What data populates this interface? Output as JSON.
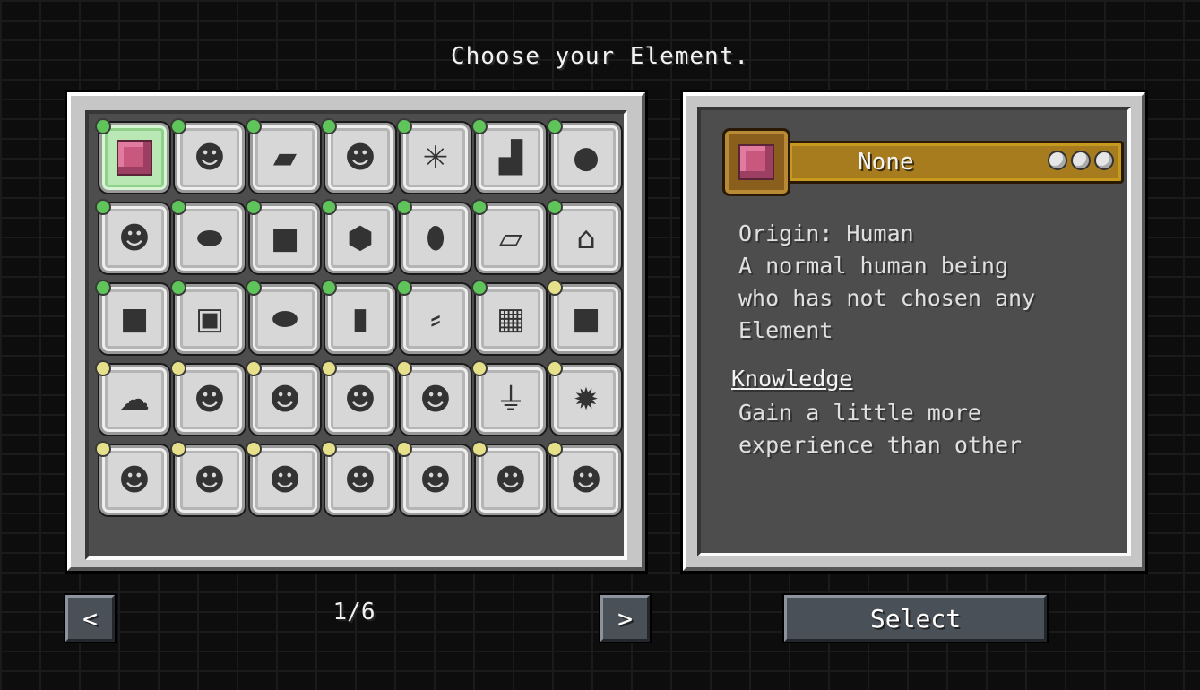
{
  "title": "Choose your Element.",
  "elements": [
    {
      "icon": "pink-cube-icon",
      "glyph": "",
      "dot": "#5fc55a",
      "selected": true
    },
    {
      "icon": "human-portrait-icon",
      "glyph": "☻",
      "dot": "#5fc55a"
    },
    {
      "icon": "purple-book-icon",
      "glyph": "▰",
      "dot": "#5fc55a"
    },
    {
      "icon": "werecat-portrait-icon",
      "glyph": "☻",
      "dot": "#5fc55a"
    },
    {
      "icon": "cobweb-icon",
      "glyph": "✳",
      "dot": "#5fc55a"
    },
    {
      "icon": "dark-altar-icon",
      "glyph": "▟",
      "dot": "#5fc55a"
    },
    {
      "icon": "clay-pot-icon",
      "glyph": "●",
      "dot": "#5fc55a"
    },
    {
      "icon": "goblin-portrait-icon",
      "glyph": "☻",
      "dot": "#5fc55a"
    },
    {
      "icon": "green-slime-icon",
      "glyph": "⬬",
      "dot": "#5fc55a"
    },
    {
      "icon": "ice-block-icon",
      "glyph": "■",
      "dot": "#5fc55a"
    },
    {
      "icon": "emerald-icon",
      "glyph": "⬢",
      "dot": "#5fc55a"
    },
    {
      "icon": "spotted-egg-icon",
      "glyph": "⬮",
      "dot": "#5fc55a"
    },
    {
      "icon": "paper-scroll-icon",
      "glyph": "▱",
      "dot": "#5fc55a"
    },
    {
      "icon": "lantern-icon",
      "glyph": "⌂",
      "dot": "#5fc55a"
    },
    {
      "icon": "snow-block-icon",
      "glyph": "■",
      "dot": "#5fc55a"
    },
    {
      "icon": "chest-icon",
      "glyph": "▣",
      "dot": "#5fc55a"
    },
    {
      "icon": "lily-pad-icon",
      "glyph": "⬬",
      "dot": "#5fc55a"
    },
    {
      "icon": "wooden-door-icon",
      "glyph": "▮",
      "dot": "#5fc55a"
    },
    {
      "icon": "pickaxe-icon",
      "glyph": "⸗",
      "dot": "#5fc55a"
    },
    {
      "icon": "crafting-table-icon",
      "glyph": "▦",
      "dot": "#5fc55a"
    },
    {
      "icon": "stone-block-icon",
      "glyph": "■",
      "dot": "#e6e08a"
    },
    {
      "icon": "blue-ice-chunk-icon",
      "glyph": "☁",
      "dot": "#e6e08a"
    },
    {
      "icon": "pale-ghoul-portrait-icon",
      "glyph": "☻",
      "dot": "#e6e08a"
    },
    {
      "icon": "red-demon-portrait-icon",
      "glyph": "☻",
      "dot": "#e6e08a"
    },
    {
      "icon": "bearded-man-portrait-icon",
      "glyph": "☻",
      "dot": "#e6e08a"
    },
    {
      "icon": "blonde-warrior-portrait-icon",
      "glyph": "☻",
      "dot": "#e6e08a"
    },
    {
      "icon": "golden-boots-icon",
      "glyph": "⏚",
      "dot": "#e6e08a"
    },
    {
      "icon": "fire-icon",
      "glyph": "✹",
      "dot": "#e6e08a"
    },
    {
      "icon": "white-yeti-portrait-icon",
      "glyph": "☻",
      "dot": "#e6e08a"
    },
    {
      "icon": "purple-imp-portrait-icon",
      "glyph": "☻",
      "dot": "#e6e08a"
    },
    {
      "icon": "frost-spirit-portrait-icon",
      "glyph": "☻",
      "dot": "#e6e08a"
    },
    {
      "icon": "elf-woman-portrait-icon",
      "glyph": "☻",
      "dot": "#e6e08a"
    },
    {
      "icon": "pink-haired-woman-portrait-icon",
      "glyph": "☻",
      "dot": "#e6e08a"
    },
    {
      "icon": "fox-icon",
      "glyph": "☻",
      "dot": "#e6e08a"
    },
    {
      "icon": "forest-druid-portrait-icon",
      "glyph": "☻",
      "dot": "#e6e08a"
    }
  ],
  "info": {
    "name": "None",
    "description_lines": [
      "Origin: Human",
      "A normal human being",
      "who has not chosen any",
      "Element"
    ],
    "knowledge_heading": "Knowledge",
    "knowledge_lines": [
      "Gain a little more",
      "experience than other"
    ]
  },
  "pagination": {
    "prev": "<",
    "next": ">",
    "page": "1/6"
  },
  "select_label": "Select",
  "colors": {
    "header_gold": "#a67c1e",
    "selected_green": "#b9e8b5",
    "dot_green": "#5fc55a",
    "dot_yellow": "#e6e08a"
  }
}
